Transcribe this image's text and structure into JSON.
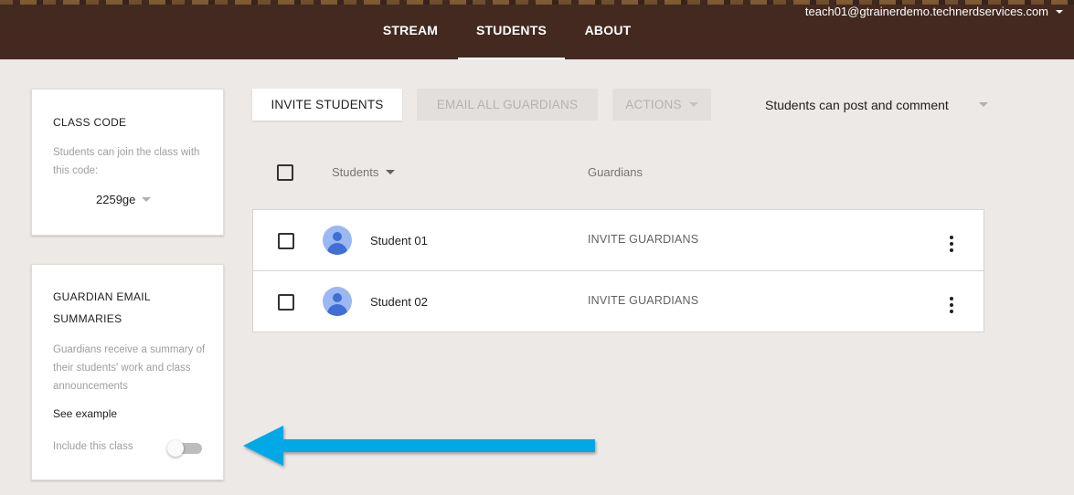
{
  "header": {
    "tabs": [
      {
        "label": "STREAM"
      },
      {
        "label": "STUDENTS"
      },
      {
        "label": "ABOUT"
      }
    ],
    "active_tab": "STUDENTS",
    "account_email": "teach01@gtrainerdemo.technerdservices.com",
    "bar_color": "#43291f"
  },
  "class_code_card": {
    "title": "CLASS CODE",
    "description": "Students can join the class with this code:",
    "code": "2259ge"
  },
  "guardian_card": {
    "title": "GUARDIAN EMAIL SUMMARIES",
    "description": "Guardians receive a summary of their students' work and class announcements",
    "see_example": "See example",
    "include_label": "Include this class",
    "include_enabled": false
  },
  "toolbar": {
    "invite_students": "INVITE STUDENTS",
    "email_all_guardians": "EMAIL ALL GUARDIANS",
    "actions": "ACTIONS",
    "permission": "Students can post and comment"
  },
  "table": {
    "students_header": "Students",
    "guardians_header": "Guardians",
    "rows": [
      {
        "name": "Student 01",
        "guardian_action": "INVITE GUARDIANS"
      },
      {
        "name": "Student 02",
        "guardian_action": "INVITE GUARDIANS"
      }
    ]
  },
  "annotation": {
    "arrow_color": "#03a9e6",
    "icon": "arrow-left-icon"
  }
}
